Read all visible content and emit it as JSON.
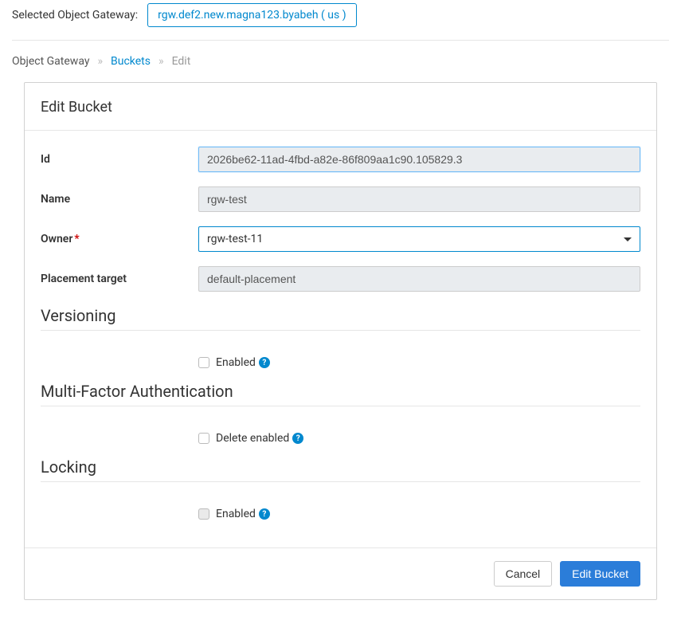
{
  "topBar": {
    "label": "Selected Object Gateway:",
    "selected": "rgw.def2.new.magna123.byabeh ( us )"
  },
  "breadcrumbs": {
    "root": "Object Gateway",
    "link": "Buckets",
    "current": "Edit"
  },
  "panel": {
    "title": "Edit Bucket",
    "fields": {
      "idLabel": "Id",
      "idValue": "2026be62-11ad-4fbd-a82e-86f809aa1c90.105829.3",
      "nameLabel": "Name",
      "nameValue": "rgw-test",
      "ownerLabel": "Owner",
      "ownerValue": "rgw-test-11",
      "placementLabel": "Placement target",
      "placementValue": "default-placement"
    },
    "sections": {
      "versioning": {
        "title": "Versioning",
        "enabledLabel": "Enabled"
      },
      "mfa": {
        "title": "Multi-Factor Authentication",
        "deleteEnabledLabel": "Delete enabled"
      },
      "locking": {
        "title": "Locking",
        "enabledLabel": "Enabled"
      }
    },
    "footer": {
      "cancel": "Cancel",
      "submit": "Edit Bucket"
    }
  }
}
